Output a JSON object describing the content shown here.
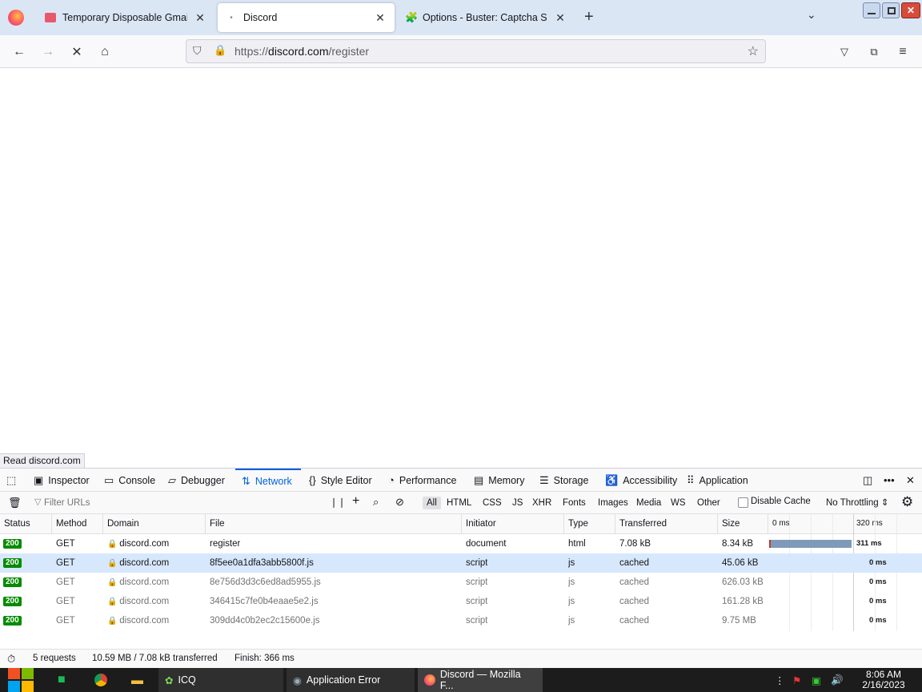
{
  "tabs": [
    {
      "label": "Temporary Disposable Gmail | ",
      "icon": "mail-icon",
      "active": false
    },
    {
      "label": "Discord",
      "icon": "loading-dot-icon",
      "active": true
    },
    {
      "label": "Options - Buster: Captcha Sol",
      "icon": "puzzle-icon",
      "active": false
    }
  ],
  "url": {
    "protocol": "https://",
    "domain": "discord.com",
    "path": "/register"
  },
  "status_tooltip": "Read discord.com",
  "devtools": {
    "tabs": [
      "Inspector",
      "Console",
      "Debugger",
      "Network",
      "Style Editor",
      "Performance",
      "Memory",
      "Storage",
      "Accessibility",
      "Application"
    ],
    "selected_tab": "Network",
    "filter_placeholder": "Filter URLs",
    "filter_types": [
      "All",
      "HTML",
      "CSS",
      "JS",
      "XHR",
      "Fonts",
      "Images",
      "Media",
      "WS",
      "Other"
    ],
    "disable_cache_label": "Disable Cache",
    "throttling_label": "No Throttling ⇕",
    "columns": [
      "Status",
      "Method",
      "Domain",
      "File",
      "Initiator",
      "Type",
      "Transferred",
      "Size"
    ],
    "waterfall_ticks": [
      "0 ms",
      "320 ms"
    ],
    "requests": [
      {
        "status": "200",
        "method": "GET",
        "domain": "discord.com",
        "file": "register",
        "initiator": "document",
        "type": "html",
        "transferred": "7.08 kB",
        "size": "8.34 kB",
        "timing": "311 ms"
      },
      {
        "status": "200",
        "method": "GET",
        "domain": "discord.com",
        "file": "8f5ee0a1dfa3abb5800f.js",
        "initiator": "script",
        "type": "js",
        "transferred": "cached",
        "size": "45.06 kB",
        "timing": "0 ms"
      },
      {
        "status": "200",
        "method": "GET",
        "domain": "discord.com",
        "file": "8e756d3d3c6ed8ad5955.js",
        "initiator": "script",
        "type": "js",
        "transferred": "cached",
        "size": "626.03 kB",
        "timing": "0 ms"
      },
      {
        "status": "200",
        "method": "GET",
        "domain": "discord.com",
        "file": "346415c7fe0b4eaae5e2.js",
        "initiator": "script",
        "type": "js",
        "transferred": "cached",
        "size": "161.28 kB",
        "timing": "0 ms"
      },
      {
        "status": "200",
        "method": "GET",
        "domain": "discord.com",
        "file": "309dd4c0b2ec2c15600e.js",
        "initiator": "script",
        "type": "js",
        "transferred": "cached",
        "size": "9.75 MB",
        "timing": "0 ms"
      }
    ],
    "summary": {
      "requests": "5 requests",
      "transferred": "10.59 MB / 7.08 kB transferred",
      "finish": "Finish: 366 ms"
    }
  },
  "taskbar": {
    "items": [
      "ICQ",
      "Application Error",
      "Discord — Mozilla F..."
    ],
    "time": "8:06 AM",
    "date": "2/16/2023"
  },
  "colors": {
    "accent": "#0060df",
    "status_ok": "#058b00",
    "selected_row": "#d7e8fd"
  }
}
